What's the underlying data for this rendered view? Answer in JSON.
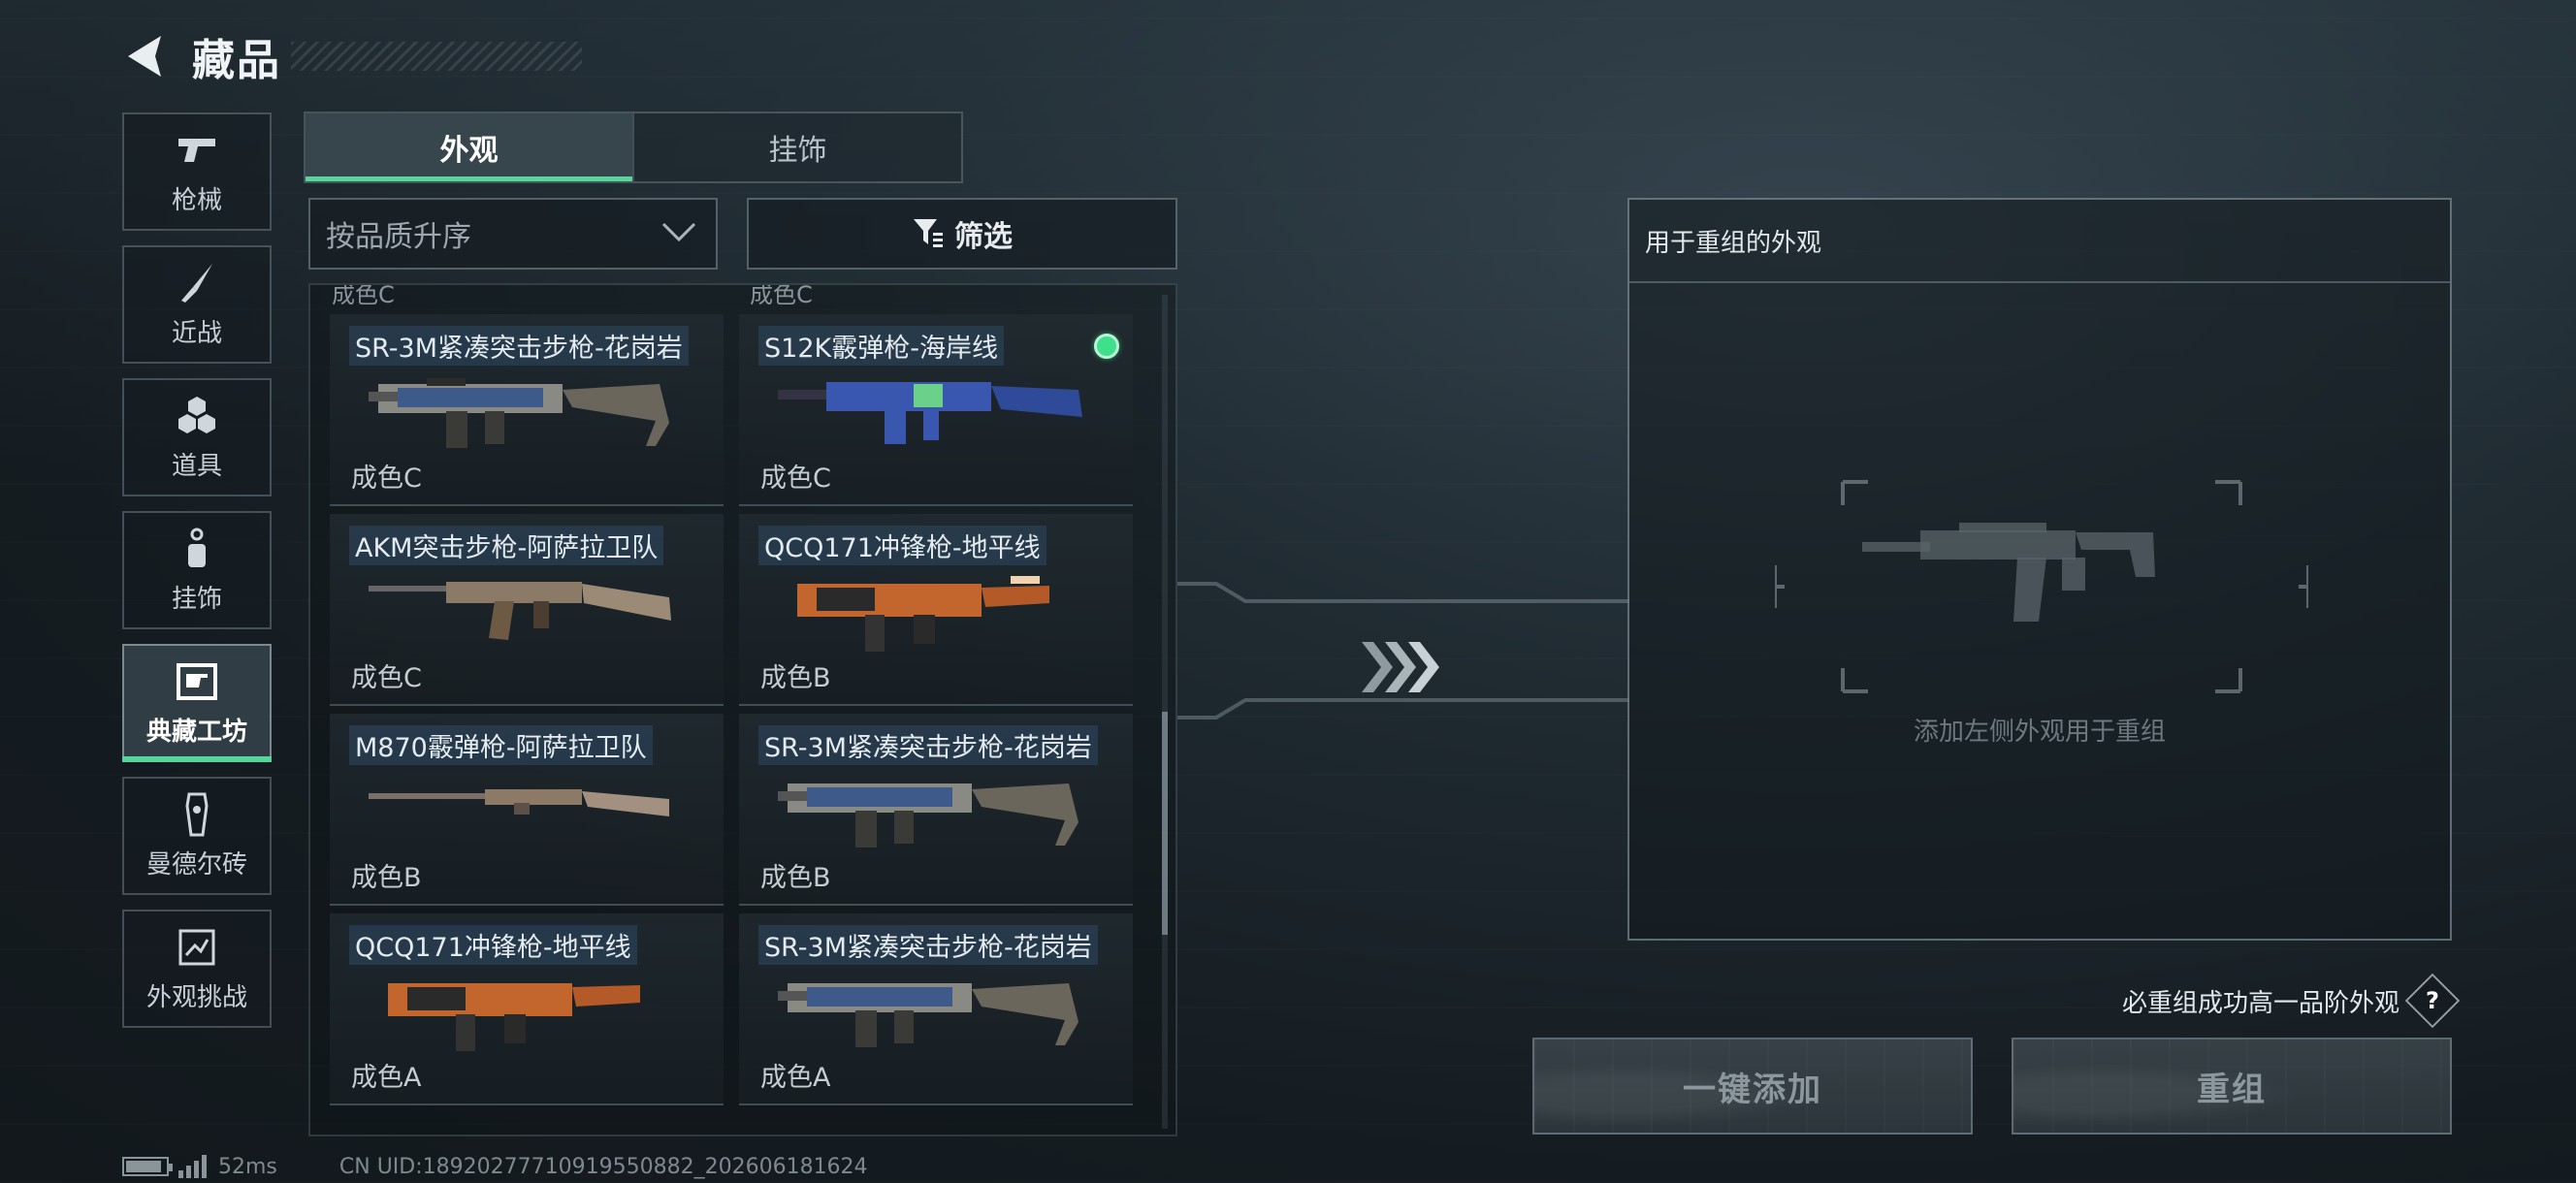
{
  "header": {
    "title": "藏品",
    "back_icon": "back-arrow-icon"
  },
  "side_nav": {
    "items": [
      {
        "label": "枪械",
        "icon": "pistol-icon",
        "active": false
      },
      {
        "label": "近战",
        "icon": "knife-icon",
        "active": false
      },
      {
        "label": "道具",
        "icon": "hex-cluster-icon",
        "active": false
      },
      {
        "label": "挂饰",
        "icon": "charm-icon",
        "active": false
      },
      {
        "label": "典藏工坊",
        "icon": "workshop-icon",
        "active": true
      },
      {
        "label": "曼德尔砖",
        "icon": "brick-icon",
        "active": false
      },
      {
        "label": "外观挑战",
        "icon": "challenge-icon",
        "active": false
      }
    ]
  },
  "tabs": [
    {
      "label": "外观",
      "active": true
    },
    {
      "label": "挂饰",
      "active": false
    }
  ],
  "sort": {
    "value": "按品质升序",
    "icon": "chevron-down-icon"
  },
  "filter": {
    "label": "筛选",
    "icon": "filter-icon"
  },
  "items_partial_top": [
    "成色C",
    "成色C"
  ],
  "items": [
    [
      {
        "name": "SR-3M紧凑突击步枪-花岗岩",
        "quality": "成色C",
        "selected": false,
        "gun": "smg"
      },
      {
        "name": "S12K霰弹枪-海岸线",
        "quality": "成色C",
        "selected": true,
        "gun": "shotgun"
      }
    ],
    [
      {
        "name": "AKM突击步枪-阿萨拉卫队",
        "quality": "成色C",
        "selected": false,
        "gun": "ak"
      },
      {
        "name": "QCQ171冲锋枪-地平线",
        "quality": "成色B",
        "selected": false,
        "gun": "qcq"
      }
    ],
    [
      {
        "name": "M870霰弹枪-阿萨拉卫队",
        "quality": "成色B",
        "selected": false,
        "gun": "pump"
      },
      {
        "name": "SR-3M紧凑突击步枪-花岗岩",
        "quality": "成色B",
        "selected": false,
        "gun": "smg"
      }
    ],
    [
      {
        "name": "QCQ171冲锋枪-地平线",
        "quality": "成色A",
        "selected": false,
        "gun": "qcq"
      },
      {
        "name": "SR-3M紧凑突击步枪-花岗岩",
        "quality": "成色A",
        "selected": false,
        "gun": "smg"
      }
    ]
  ],
  "recombine": {
    "title": "用于重组的外观",
    "hint": "添加左侧外观用于重组",
    "placeholder_icon": "rifle-silhouette-icon"
  },
  "guarantee": {
    "text": "必重组成功高一品阶外观",
    "help": "?"
  },
  "buttons": {
    "add_all": "一键添加",
    "recombine": "重组"
  },
  "footer": {
    "ping": "52ms",
    "uid": "CN UID:18920277710919550882_202606181624"
  },
  "colors": {
    "accent": "#57d59a",
    "selected_dot": "#3fe08c"
  }
}
